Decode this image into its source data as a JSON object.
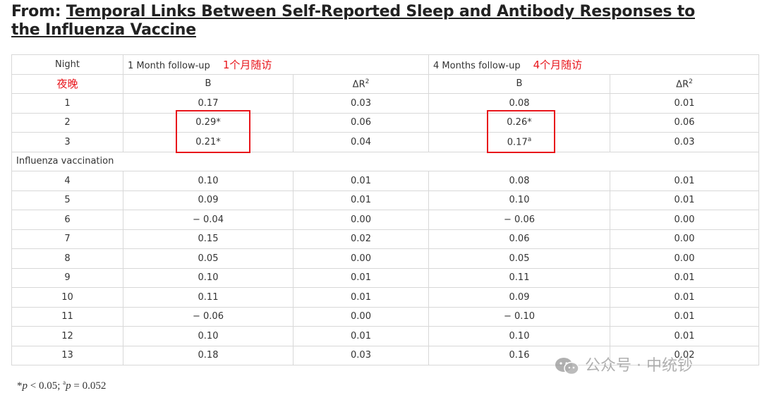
{
  "title": {
    "prefix": "From: ",
    "link": "Temporal Links Between Self-Reported Sleep and Antibody Responses to the Influenza Vaccine"
  },
  "table": {
    "header": {
      "night": "Night",
      "night_annotation": "夜晚",
      "group1": "1 Month follow-up",
      "group1_annotation": "1个月随访",
      "group2": "4 Months follow-up",
      "group2_annotation": "4个月随访",
      "col_b": "B",
      "col_dr": "ΔR",
      "col_dr_sup": "2"
    },
    "rows_a": [
      {
        "night": "1",
        "b1": "0.17",
        "dr1": "0.03",
        "b2": "0.08",
        "b2_sup": "",
        "dr2": "0.01"
      },
      {
        "night": "2",
        "b1": "0.29*",
        "dr1": "0.06",
        "b2": "0.26*",
        "b2_sup": "",
        "dr2": "0.06"
      },
      {
        "night": "3",
        "b1": "0.21*",
        "dr1": "0.04",
        "b2": "0.17",
        "b2_sup": "a",
        "dr2": "0.03"
      }
    ],
    "section_label": "Influenza vaccination",
    "rows_b": [
      {
        "night": "4",
        "b1": "0.10",
        "dr1": "0.01",
        "b2": "0.08",
        "dr2": "0.01"
      },
      {
        "night": "5",
        "b1": "0.09",
        "dr1": "0.01",
        "b2": "0.10",
        "dr2": "0.01"
      },
      {
        "night": "6",
        "b1": "− 0.04",
        "dr1": "0.00",
        "b2": "− 0.06",
        "dr2": "0.00"
      },
      {
        "night": "7",
        "b1": "0.15",
        "dr1": "0.02",
        "b2": "0.06",
        "dr2": "0.00"
      },
      {
        "night": "8",
        "b1": "0.05",
        "dr1": "0.00",
        "b2": "0.05",
        "dr2": "0.00"
      },
      {
        "night": "9",
        "b1": "0.10",
        "dr1": "0.01",
        "b2": "0.11",
        "dr2": "0.01"
      },
      {
        "night": "10",
        "b1": "0.11",
        "dr1": "0.01",
        "b2": "0.09",
        "dr2": "0.01"
      },
      {
        "night": "11",
        "b1": "− 0.06",
        "dr1": "0.00",
        "b2": "− 0.10",
        "dr2": "0.01"
      },
      {
        "night": "12",
        "b1": "0.10",
        "dr1": "0.01",
        "b2": "0.10",
        "dr2": "0.01"
      },
      {
        "night": "13",
        "b1": "0.18",
        "dr1": "0.03",
        "b2": "0.16",
        "dr2": "0.02"
      }
    ]
  },
  "footnote": {
    "p1": "p",
    "lt": " < 0.05; ",
    "sup_a": "a",
    "p2": "p",
    "eq": " = 0.052"
  },
  "watermark": {
    "text": "公众号 · 中统钞"
  },
  "colors": {
    "annotation": "#e8151b",
    "border": "#d8d8d8"
  }
}
